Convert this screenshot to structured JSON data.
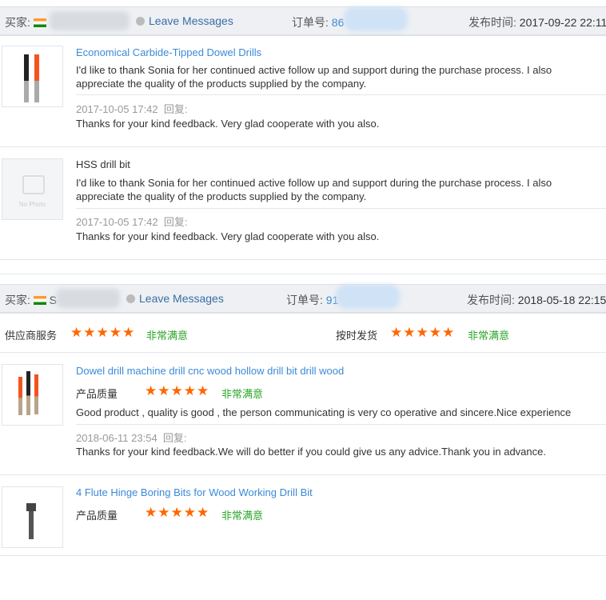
{
  "labels": {
    "buyer": "买家:",
    "leave": "Leave Messages",
    "order": "订单号:",
    "posted": "发布时间:",
    "reply": "回复:",
    "no_photo": "No Photo"
  },
  "feedbacks": [
    {
      "buyer_initial": "",
      "order_prefix": "86",
      "order_mid": "24",
      "time": "2017-09-22 22:11",
      "items": [
        {
          "title": "Economical Carbide-Tipped Dowel Drills",
          "text": "I'd like to thank Sonia for her continued active follow up and support during the purchase process. I also appreciate the quality of the products supplied by the company.",
          "date": "2017-10-05 17:42",
          "reply": "Thanks for your kind feedback. Very glad cooperate with you also."
        },
        {
          "title": "HSS drill bit",
          "text": "I'd like to thank Sonia for her continued active follow up and support during the purchase process. I also appreciate the quality of the products supplied by the company.",
          "date": "2017-10-05 17:42",
          "reply": "Thanks for your kind feedback. Very glad cooperate with you also."
        }
      ]
    },
    {
      "buyer_initial": "S",
      "order_prefix": "91",
      "time": "2018-05-18 22:15",
      "ratings": [
        {
          "label": "供应商服务",
          "stars": 5,
          "verdict": "非常满意"
        },
        {
          "label": "按时发货",
          "stars": 5,
          "verdict": "非常满意"
        }
      ],
      "items": [
        {
          "title": "Dowel drill machine drill cnc wood hollow drill bit drill wood",
          "quality_label": "产品质量",
          "stars": 5,
          "verdict": "非常满意",
          "text": "Good product , quality is good , the person communicating is very co operative and sincere.Nice experience",
          "date": "2018-06-11 23:54",
          "reply": "Thanks for your kind feedback.We will do better if you could give us any advice.Thank you in advance."
        },
        {
          "title": "4 Flute Hinge Boring Bits for Wood Working Drill Bit",
          "quality_label": "产品质量",
          "stars": 5,
          "verdict": "非常满意"
        }
      ]
    }
  ],
  "star_glyph": "★★★★★"
}
